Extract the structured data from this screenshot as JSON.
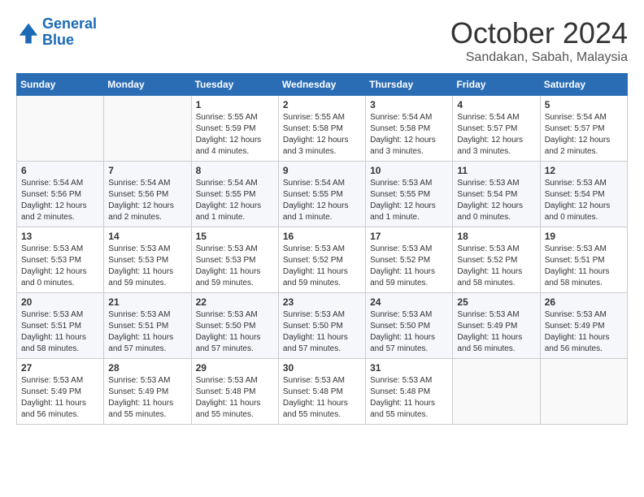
{
  "header": {
    "logo_line1": "General",
    "logo_line2": "Blue",
    "title": "October 2024",
    "location": "Sandakan, Sabah, Malaysia"
  },
  "days_of_week": [
    "Sunday",
    "Monday",
    "Tuesday",
    "Wednesday",
    "Thursday",
    "Friday",
    "Saturday"
  ],
  "weeks": [
    [
      {
        "day": "",
        "sunrise": "",
        "sunset": "",
        "daylight": ""
      },
      {
        "day": "",
        "sunrise": "",
        "sunset": "",
        "daylight": ""
      },
      {
        "day": "1",
        "sunrise": "Sunrise: 5:55 AM",
        "sunset": "Sunset: 5:59 PM",
        "daylight": "Daylight: 12 hours and 4 minutes."
      },
      {
        "day": "2",
        "sunrise": "Sunrise: 5:55 AM",
        "sunset": "Sunset: 5:58 PM",
        "daylight": "Daylight: 12 hours and 3 minutes."
      },
      {
        "day": "3",
        "sunrise": "Sunrise: 5:54 AM",
        "sunset": "Sunset: 5:58 PM",
        "daylight": "Daylight: 12 hours and 3 minutes."
      },
      {
        "day": "4",
        "sunrise": "Sunrise: 5:54 AM",
        "sunset": "Sunset: 5:57 PM",
        "daylight": "Daylight: 12 hours and 3 minutes."
      },
      {
        "day": "5",
        "sunrise": "Sunrise: 5:54 AM",
        "sunset": "Sunset: 5:57 PM",
        "daylight": "Daylight: 12 hours and 2 minutes."
      }
    ],
    [
      {
        "day": "6",
        "sunrise": "Sunrise: 5:54 AM",
        "sunset": "Sunset: 5:56 PM",
        "daylight": "Daylight: 12 hours and 2 minutes."
      },
      {
        "day": "7",
        "sunrise": "Sunrise: 5:54 AM",
        "sunset": "Sunset: 5:56 PM",
        "daylight": "Daylight: 12 hours and 2 minutes."
      },
      {
        "day": "8",
        "sunrise": "Sunrise: 5:54 AM",
        "sunset": "Sunset: 5:55 PM",
        "daylight": "Daylight: 12 hours and 1 minute."
      },
      {
        "day": "9",
        "sunrise": "Sunrise: 5:54 AM",
        "sunset": "Sunset: 5:55 PM",
        "daylight": "Daylight: 12 hours and 1 minute."
      },
      {
        "day": "10",
        "sunrise": "Sunrise: 5:53 AM",
        "sunset": "Sunset: 5:55 PM",
        "daylight": "Daylight: 12 hours and 1 minute."
      },
      {
        "day": "11",
        "sunrise": "Sunrise: 5:53 AM",
        "sunset": "Sunset: 5:54 PM",
        "daylight": "Daylight: 12 hours and 0 minutes."
      },
      {
        "day": "12",
        "sunrise": "Sunrise: 5:53 AM",
        "sunset": "Sunset: 5:54 PM",
        "daylight": "Daylight: 12 hours and 0 minutes."
      }
    ],
    [
      {
        "day": "13",
        "sunrise": "Sunrise: 5:53 AM",
        "sunset": "Sunset: 5:53 PM",
        "daylight": "Daylight: 12 hours and 0 minutes."
      },
      {
        "day": "14",
        "sunrise": "Sunrise: 5:53 AM",
        "sunset": "Sunset: 5:53 PM",
        "daylight": "Daylight: 11 hours and 59 minutes."
      },
      {
        "day": "15",
        "sunrise": "Sunrise: 5:53 AM",
        "sunset": "Sunset: 5:53 PM",
        "daylight": "Daylight: 11 hours and 59 minutes."
      },
      {
        "day": "16",
        "sunrise": "Sunrise: 5:53 AM",
        "sunset": "Sunset: 5:52 PM",
        "daylight": "Daylight: 11 hours and 59 minutes."
      },
      {
        "day": "17",
        "sunrise": "Sunrise: 5:53 AM",
        "sunset": "Sunset: 5:52 PM",
        "daylight": "Daylight: 11 hours and 59 minutes."
      },
      {
        "day": "18",
        "sunrise": "Sunrise: 5:53 AM",
        "sunset": "Sunset: 5:52 PM",
        "daylight": "Daylight: 11 hours and 58 minutes."
      },
      {
        "day": "19",
        "sunrise": "Sunrise: 5:53 AM",
        "sunset": "Sunset: 5:51 PM",
        "daylight": "Daylight: 11 hours and 58 minutes."
      }
    ],
    [
      {
        "day": "20",
        "sunrise": "Sunrise: 5:53 AM",
        "sunset": "Sunset: 5:51 PM",
        "daylight": "Daylight: 11 hours and 58 minutes."
      },
      {
        "day": "21",
        "sunrise": "Sunrise: 5:53 AM",
        "sunset": "Sunset: 5:51 PM",
        "daylight": "Daylight: 11 hours and 57 minutes."
      },
      {
        "day": "22",
        "sunrise": "Sunrise: 5:53 AM",
        "sunset": "Sunset: 5:50 PM",
        "daylight": "Daylight: 11 hours and 57 minutes."
      },
      {
        "day": "23",
        "sunrise": "Sunrise: 5:53 AM",
        "sunset": "Sunset: 5:50 PM",
        "daylight": "Daylight: 11 hours and 57 minutes."
      },
      {
        "day": "24",
        "sunrise": "Sunrise: 5:53 AM",
        "sunset": "Sunset: 5:50 PM",
        "daylight": "Daylight: 11 hours and 57 minutes."
      },
      {
        "day": "25",
        "sunrise": "Sunrise: 5:53 AM",
        "sunset": "Sunset: 5:49 PM",
        "daylight": "Daylight: 11 hours and 56 minutes."
      },
      {
        "day": "26",
        "sunrise": "Sunrise: 5:53 AM",
        "sunset": "Sunset: 5:49 PM",
        "daylight": "Daylight: 11 hours and 56 minutes."
      }
    ],
    [
      {
        "day": "27",
        "sunrise": "Sunrise: 5:53 AM",
        "sunset": "Sunset: 5:49 PM",
        "daylight": "Daylight: 11 hours and 56 minutes."
      },
      {
        "day": "28",
        "sunrise": "Sunrise: 5:53 AM",
        "sunset": "Sunset: 5:49 PM",
        "daylight": "Daylight: 11 hours and 55 minutes."
      },
      {
        "day": "29",
        "sunrise": "Sunrise: 5:53 AM",
        "sunset": "Sunset: 5:48 PM",
        "daylight": "Daylight: 11 hours and 55 minutes."
      },
      {
        "day": "30",
        "sunrise": "Sunrise: 5:53 AM",
        "sunset": "Sunset: 5:48 PM",
        "daylight": "Daylight: 11 hours and 55 minutes."
      },
      {
        "day": "31",
        "sunrise": "Sunrise: 5:53 AM",
        "sunset": "Sunset: 5:48 PM",
        "daylight": "Daylight: 11 hours and 55 minutes."
      },
      {
        "day": "",
        "sunrise": "",
        "sunset": "",
        "daylight": ""
      },
      {
        "day": "",
        "sunrise": "",
        "sunset": "",
        "daylight": ""
      }
    ]
  ]
}
